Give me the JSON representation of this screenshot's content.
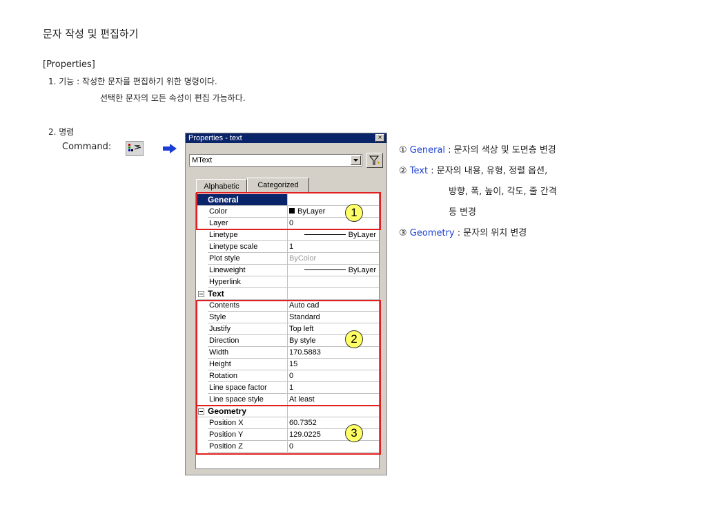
{
  "title": "문자 작성 및 편집하기",
  "section": "[Properties]",
  "desc": {
    "line1": "1. 기능 : 작성한 문자를 편집하기 위한 명령이다.",
    "line2": "선택한 문자의 모든 속성이 편집 가능하다."
  },
  "command": {
    "number_label": "2. 명령",
    "label": "Command:"
  },
  "window": {
    "title": "Properties - text",
    "close": "×",
    "object_type": "MText",
    "tabs": [
      "Alphabetic",
      "Categorized"
    ],
    "rows": [
      {
        "type": "cat",
        "name": "General",
        "value": ""
      },
      {
        "name": "Color",
        "value": "ByLayer",
        "kind": "swatch"
      },
      {
        "name": "Layer",
        "value": "0"
      },
      {
        "name": "Linetype",
        "value": "ByLayer",
        "kind": "line"
      },
      {
        "name": "Linetype scale",
        "value": "1"
      },
      {
        "name": "Plot style",
        "value": "ByColor",
        "kind": "grey"
      },
      {
        "name": "Lineweight",
        "value": "ByLayer",
        "kind": "line"
      },
      {
        "name": "Hyperlink",
        "value": ""
      },
      {
        "type": "cat",
        "name": "Text",
        "value": ""
      },
      {
        "name": "Contents",
        "value": "Auto cad"
      },
      {
        "name": "Style",
        "value": "Standard"
      },
      {
        "name": "Justify",
        "value": "Top left"
      },
      {
        "name": "Direction",
        "value": "By style"
      },
      {
        "name": "Width",
        "value": "170.5883"
      },
      {
        "name": "Height",
        "value": "15"
      },
      {
        "name": "Rotation",
        "value": "0"
      },
      {
        "name": "Line space factor",
        "value": "1"
      },
      {
        "name": "Line space style",
        "value": "At least"
      },
      {
        "type": "cat",
        "name": "Geometry",
        "value": ""
      },
      {
        "name": "Position X",
        "value": "60.7352"
      },
      {
        "name": "Position Y",
        "value": "129.0225"
      },
      {
        "name": "Position Z",
        "value": "0"
      }
    ]
  },
  "markers": [
    "1",
    "2",
    "3"
  ],
  "legend": [
    {
      "num": "①",
      "key": "General",
      "text": " : 문자의 색상 및 도면층 변경"
    },
    {
      "num": "②",
      "key": "Text",
      "text": " : 문자의 내용, 유형, 정렬 옵션,"
    },
    {
      "cont": "방향, 폭, 높이, 각도, 줄 간격"
    },
    {
      "cont": "등 변경"
    },
    {
      "num": "③",
      "key": "Geometry",
      "text": " : 문자의 위치 변경"
    }
  ],
  "colors": {
    "highlight": "#e02020",
    "marker": "#ffff66",
    "keyword": "#1b3fd6",
    "titlebar": "#0a246a"
  }
}
